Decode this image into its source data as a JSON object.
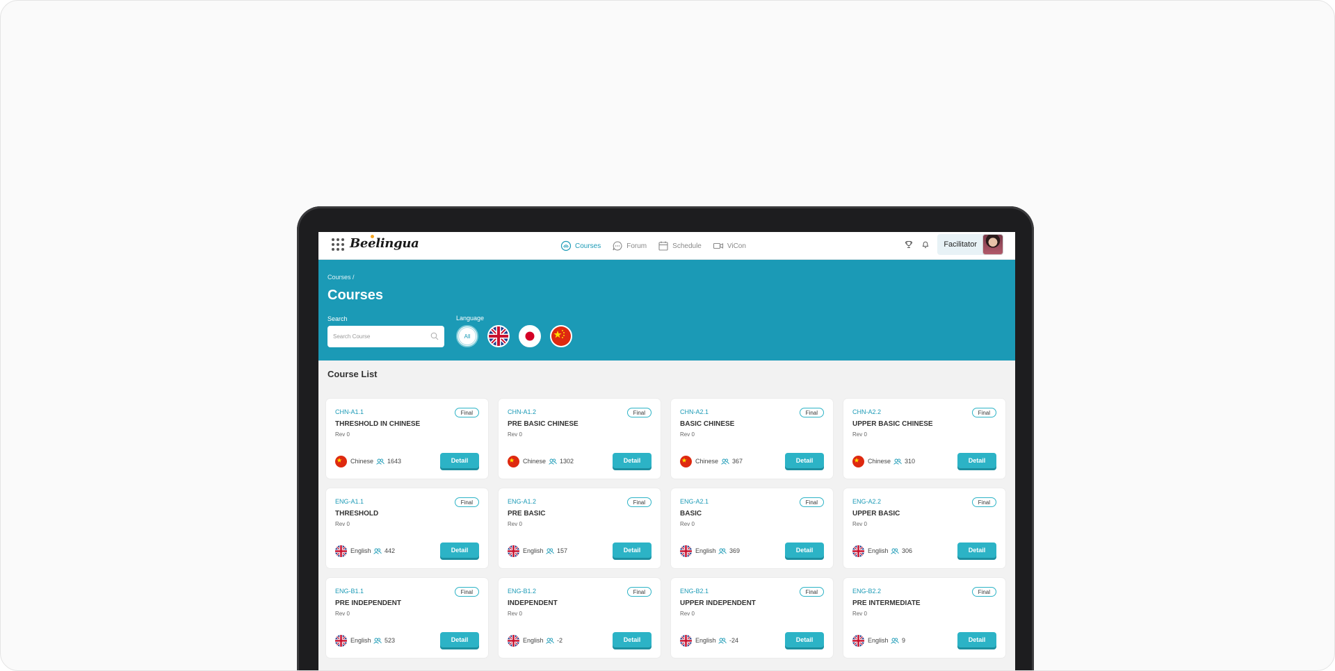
{
  "app": {
    "logo": "Beelingua",
    "nav": [
      {
        "label": "Courses",
        "icon": "courses-icon",
        "active": true
      },
      {
        "label": "Forum",
        "icon": "forum-icon",
        "active": false
      },
      {
        "label": "Schedule",
        "icon": "calendar-icon",
        "active": false
      },
      {
        "label": "ViCon",
        "icon": "video-icon",
        "active": false
      }
    ],
    "role": "Facilitator"
  },
  "hero": {
    "breadcrumb": "Courses /",
    "title": "Courses",
    "search_label": "Search",
    "search_placeholder": "Search Course",
    "language_label": "Language",
    "language_all": "All",
    "languages": [
      "All",
      "English",
      "Japanese",
      "Chinese"
    ]
  },
  "list": {
    "title": "Course List",
    "detail_label": "Detail",
    "courses": [
      {
        "code": "CHN-A1.1",
        "name": "THRESHOLD IN CHINESE",
        "rev": "Rev 0",
        "status": "Final",
        "language": "Chinese",
        "users": "1643"
      },
      {
        "code": "CHN-A1.2",
        "name": "PRE BASIC CHINESE",
        "rev": "Rev 0",
        "status": "Final",
        "language": "Chinese",
        "users": "1302"
      },
      {
        "code": "CHN-A2.1",
        "name": "BASIC CHINESE",
        "rev": "Rev 0",
        "status": "Final",
        "language": "Chinese",
        "users": "367"
      },
      {
        "code": "CHN-A2.2",
        "name": "UPPER BASIC CHINESE",
        "rev": "Rev 0",
        "status": "Final",
        "language": "Chinese",
        "users": "310"
      },
      {
        "code": "ENG-A1.1",
        "name": "THRESHOLD",
        "rev": "Rev 0",
        "status": "Final",
        "language": "English",
        "users": "442"
      },
      {
        "code": "ENG-A1.2",
        "name": "PRE BASIC",
        "rev": "Rev 0",
        "status": "Final",
        "language": "English",
        "users": "157"
      },
      {
        "code": "ENG-A2.1",
        "name": "BASIC",
        "rev": "Rev 0",
        "status": "Final",
        "language": "English",
        "users": "369"
      },
      {
        "code": "ENG-A2.2",
        "name": "UPPER BASIC",
        "rev": "Rev 0",
        "status": "Final",
        "language": "English",
        "users": "306"
      },
      {
        "code": "ENG-B1.1",
        "name": "PRE INDEPENDENT",
        "rev": "Rev 0",
        "status": "Final",
        "language": "English",
        "users": "523"
      },
      {
        "code": "ENG-B1.2",
        "name": "INDEPENDENT",
        "rev": "Rev 0",
        "status": "Final",
        "language": "English",
        "users": "-2"
      },
      {
        "code": "ENG-B2.1",
        "name": "UPPER INDEPENDENT",
        "rev": "Rev 0",
        "status": "Final",
        "language": "English",
        "users": "-24"
      },
      {
        "code": "ENG-B2.2",
        "name": "PRE INTERMEDIATE",
        "rev": "Rev 0",
        "status": "Final",
        "language": "English",
        "users": "9"
      }
    ]
  },
  "colors": {
    "accent": "#1b9ab6",
    "button": "#2cb3c6"
  }
}
